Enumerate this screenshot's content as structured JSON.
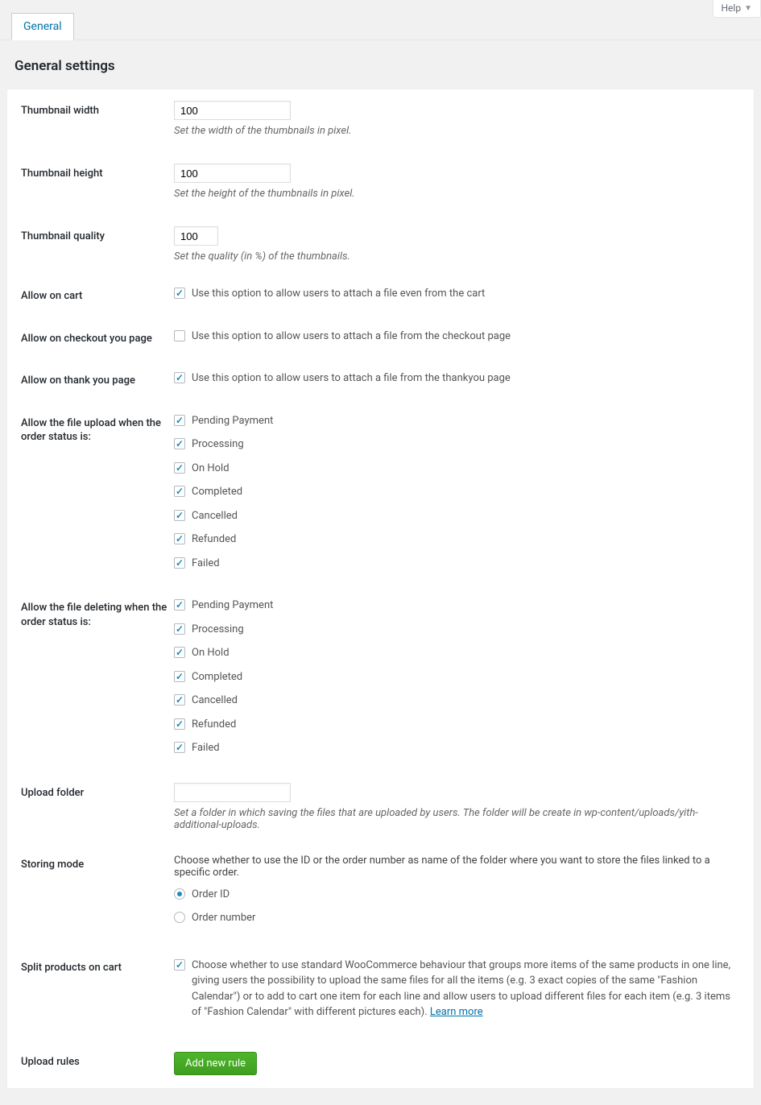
{
  "help": {
    "label": "Help"
  },
  "tabs": {
    "general": "General"
  },
  "page_title": "General settings",
  "thumb_width": {
    "label": "Thumbnail width",
    "value": "100",
    "desc": "Set the width of the thumbnails in pixel."
  },
  "thumb_height": {
    "label": "Thumbnail height",
    "value": "100",
    "desc": "Set the height of the thumbnails in pixel."
  },
  "thumb_quality": {
    "label": "Thumbnail quality",
    "value": "100",
    "desc": "Set the quality (in %) of the thumbnails."
  },
  "allow_cart": {
    "label": "Allow on cart",
    "desc": "Use this option to allow users to attach a file even from the cart"
  },
  "allow_checkout": {
    "label": "Allow on checkout you page",
    "desc": "Use this option to allow users to attach a file from the checkout page"
  },
  "allow_thankyou": {
    "label": "Allow on thank you page",
    "desc": "Use this option to allow users to attach a file from the thankyou page"
  },
  "upload_status": {
    "label": "Allow the file upload when the order status is:",
    "items": [
      "Pending Payment",
      "Processing",
      "On Hold",
      "Completed",
      "Cancelled",
      "Refunded",
      "Failed"
    ]
  },
  "delete_status": {
    "label": "Allow the file deleting when the order status is:",
    "items": [
      "Pending Payment",
      "Processing",
      "On Hold",
      "Completed",
      "Cancelled",
      "Refunded",
      "Failed"
    ]
  },
  "upload_folder": {
    "label": "Upload folder",
    "desc": "Set a folder in which saving the files that are uploaded by users. The folder will be create in wp-content/uploads/yith-additional-uploads."
  },
  "storing": {
    "label": "Storing mode",
    "instr": "Choose whether to use the ID or the order number as name of the folder where you want to store the files linked to a specific order.",
    "opt1": "Order ID",
    "opt2": "Order number"
  },
  "split": {
    "label": "Split products on cart",
    "desc": "Choose whether to use standard WooCommerce behaviour that groups more items of the same products in one line, giving users the possibility to upload the same files for all the items (e.g. 3 exact copies of the same \"Fashion Calendar\") or to add to cart one item for each line and allow users to upload different files for each item (e.g. 3 items of \"Fashion Calendar\" with different pictures each). ",
    "link": "Learn more"
  },
  "rules": {
    "label": "Upload rules",
    "button": "Add new rule"
  }
}
